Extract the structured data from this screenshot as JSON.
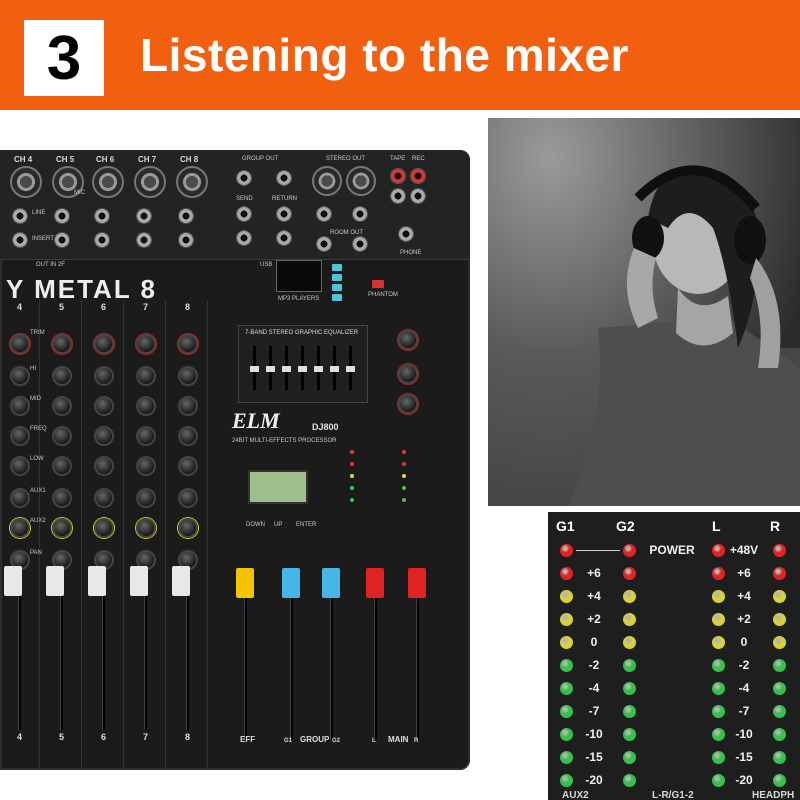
{
  "banner": {
    "step_number": "3",
    "title": "Listening to the mixer",
    "background_color": "#f0600f"
  },
  "mixer": {
    "channel_headers": [
      "CH 4",
      "CH 5",
      "CH 6",
      "CH 7",
      "CH 8"
    ],
    "section_labels": {
      "group_out": "GROUP OUT",
      "stereo_out": "STEREO OUT",
      "tape": "TAPE",
      "rec": "REC",
      "send": "SEND",
      "return": "RETURN",
      "room_out": "ROOM OUT",
      "phone": "PHONE",
      "mic": "MIC",
      "line": "LINE",
      "insert": "INSERT",
      "usb": "USB",
      "mp3_players": "MP3 PLAYERS",
      "phantom": "PHANTOM",
      "out_in": "OUT IN 2F"
    },
    "brand_text": "Y METAL 8",
    "logo": "ELM",
    "model": "DJ800",
    "eq_title": "7-BAND STEREO GRAPHIC EQUALIZER",
    "effects_title": "24BIT MULTI-EFFECTS PROCESSOR",
    "lcd_buttons": [
      "DOWN",
      "UP",
      "ENTER"
    ],
    "strip_numbers": [
      "4",
      "5",
      "6",
      "7",
      "8"
    ],
    "knob_labels": [
      "TRIM",
      "HI",
      "MID",
      "FREQ",
      "LOW",
      "AUX1",
      "AUX2",
      "PAN"
    ],
    "fader_section_labels": [
      "EFF",
      "GROUP",
      "MAIN"
    ],
    "group_sub": [
      "G1",
      "G2"
    ],
    "main_sub": [
      "L",
      "R"
    ],
    "fader_colors": {
      "eff": "#f2c300",
      "group": "#45b6e6",
      "main": "#e02424"
    }
  },
  "meter": {
    "headers": [
      "G1",
      "G2",
      "L",
      "R"
    ],
    "rows": [
      {
        "left_label": "",
        "center_label": "POWER",
        "right_label": "+48V",
        "color": "#e52222"
      },
      {
        "left_label": "+6",
        "center_label": "",
        "right_label": "+6",
        "color": "#e52222"
      },
      {
        "left_label": "+4",
        "center_label": "",
        "right_label": "+4",
        "color": "#d9d233"
      },
      {
        "left_label": "+2",
        "center_label": "",
        "right_label": "+2",
        "color": "#d9d233"
      },
      {
        "left_label": "0",
        "center_label": "",
        "right_label": "0",
        "color": "#d9d233"
      },
      {
        "left_label": "-2",
        "center_label": "",
        "right_label": "-2",
        "color": "#33c24a"
      },
      {
        "left_label": "-4",
        "center_label": "",
        "right_label": "-4",
        "color": "#33c24a"
      },
      {
        "left_label": "-7",
        "center_label": "",
        "right_label": "-7",
        "color": "#33c24a"
      },
      {
        "left_label": "-10",
        "center_label": "",
        "right_label": "-10",
        "color": "#33c24a"
      },
      {
        "left_label": "-15",
        "center_label": "",
        "right_label": "-15",
        "color": "#33c24a"
      },
      {
        "left_label": "-20",
        "center_label": "",
        "right_label": "-20",
        "color": "#33c24a"
      }
    ],
    "footer": [
      "AUX2",
      "L-R/G1-2",
      "HEADPH"
    ]
  }
}
